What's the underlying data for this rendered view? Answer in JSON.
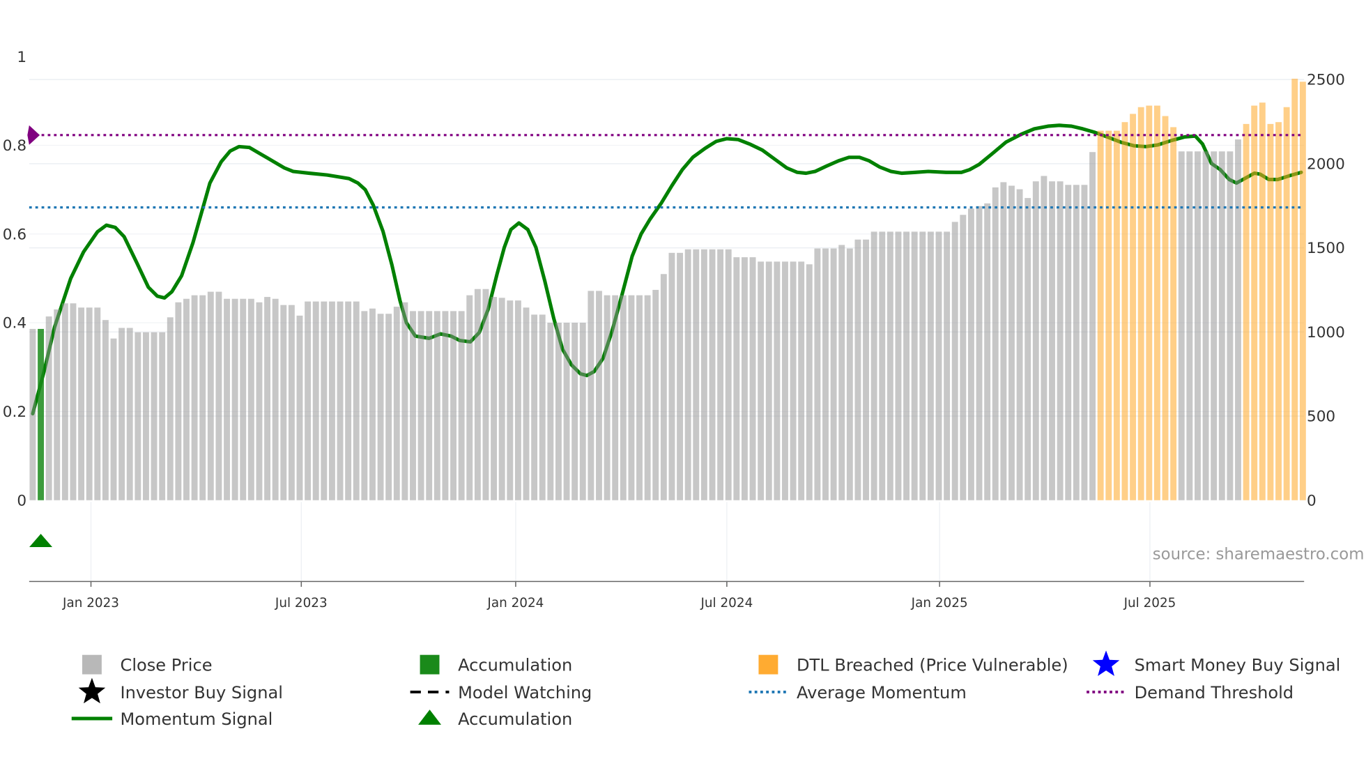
{
  "chart_data": {
    "type": "bar",
    "title": "",
    "x_unit": "week index (weekly bars)",
    "x_ticks": [
      {
        "label": "Jan 2023",
        "at": 7.2
      },
      {
        "label": "Jul 2023",
        "at": 33.2
      },
      {
        "label": "Jan 2024",
        "at": 59.7
      },
      {
        "label": "Jul 2024",
        "at": 85.8
      },
      {
        "label": "Jan 2025",
        "at": 112.1
      },
      {
        "label": "Jul 2025",
        "at": 138.1
      }
    ],
    "left_axis": {
      "range": [
        0,
        1
      ],
      "ticks": [
        "0",
        "0.2",
        "0.4",
        "0.6",
        "0.8",
        "1"
      ],
      "tick_values": [
        0,
        0.2,
        0.4,
        0.6,
        0.8,
        1
      ]
    },
    "right_axis": {
      "range": [
        0,
        2500
      ],
      "ticks": [
        "0",
        "500",
        "1000",
        "1500",
        "2000",
        "2500"
      ],
      "tick_values": [
        0,
        500,
        1000,
        1500,
        2000,
        2500
      ]
    },
    "close_price": [
      1018,
      1018,
      1092,
      1134,
      1170,
      1170,
      1145,
      1145,
      1145,
      1071,
      961,
      1024,
      1024,
      998,
      998,
      998,
      998,
      1087,
      1176,
      1197,
      1218,
      1218,
      1239,
      1239,
      1197,
      1197,
      1197,
      1197,
      1176,
      1208,
      1197,
      1160,
      1160,
      1097,
      1181,
      1181,
      1181,
      1181,
      1181,
      1181,
      1181,
      1124,
      1139,
      1108,
      1108,
      1150,
      1176,
      1124,
      1124,
      1124,
      1124,
      1124,
      1124,
      1124,
      1218,
      1255,
      1255,
      1208,
      1203,
      1187,
      1187,
      1145,
      1103,
      1103,
      1055,
      1055,
      1055,
      1055,
      1055,
      1244,
      1244,
      1218,
      1218,
      1218,
      1218,
      1218,
      1218,
      1250,
      1344,
      1470,
      1470,
      1491,
      1491,
      1491,
      1491,
      1491,
      1491,
      1444,
      1444,
      1444,
      1418,
      1418,
      1418,
      1418,
      1418,
      1418,
      1402,
      1496,
      1496,
      1496,
      1517,
      1496,
      1549,
      1549,
      1596,
      1596,
      1596,
      1596,
      1596,
      1596,
      1596,
      1596,
      1596,
      1596,
      1654,
      1696,
      1733,
      1748,
      1764,
      1859,
      1890,
      1869,
      1848,
      1796,
      1895,
      1927,
      1895,
      1895,
      1874,
      1874,
      1874,
      2069,
      2196,
      2196,
      2196,
      2247,
      2296,
      2336,
      2345,
      2345,
      2283,
      2217,
      2073,
      2073,
      2073,
      2073,
      2073,
      2073,
      2073,
      2144,
      2236,
      2345,
      2363,
      2236,
      2247,
      2336,
      2505,
      2487
    ],
    "accumulation_bar_indices": [
      1
    ],
    "dtl_breached_ranges": [
      [
        132,
        141
      ],
      [
        150,
        157
      ]
    ],
    "momentum_signal": [
      [
        0,
        0.195
      ],
      [
        1.4,
        0.29
      ],
      [
        2.7,
        0.39
      ],
      [
        4.7,
        0.5
      ],
      [
        6.3,
        0.56
      ],
      [
        8,
        0.605
      ],
      [
        9.1,
        0.62
      ],
      [
        10.2,
        0.615
      ],
      [
        11.3,
        0.594
      ],
      [
        12.9,
        0.534
      ],
      [
        14.3,
        0.48
      ],
      [
        15.4,
        0.46
      ],
      [
        16.3,
        0.456
      ],
      [
        17.2,
        0.47
      ],
      [
        18.4,
        0.506
      ],
      [
        19.8,
        0.58
      ],
      [
        20.9,
        0.65
      ],
      [
        21.9,
        0.715
      ],
      [
        23.3,
        0.763
      ],
      [
        24.4,
        0.787
      ],
      [
        25.5,
        0.797
      ],
      [
        26.8,
        0.795
      ],
      [
        28.2,
        0.78
      ],
      [
        29.8,
        0.763
      ],
      [
        31.1,
        0.749
      ],
      [
        32.2,
        0.741
      ],
      [
        34.2,
        0.737
      ],
      [
        36.4,
        0.733
      ],
      [
        39.1,
        0.725
      ],
      [
        40.2,
        0.715
      ],
      [
        41.1,
        0.7
      ],
      [
        42.1,
        0.665
      ],
      [
        43.3,
        0.606
      ],
      [
        44.4,
        0.53
      ],
      [
        45.4,
        0.45
      ],
      [
        46.2,
        0.4
      ],
      [
        47.3,
        0.37
      ],
      [
        49,
        0.365
      ],
      [
        50.4,
        0.375
      ],
      [
        51.7,
        0.37
      ],
      [
        52.8,
        0.36
      ],
      [
        54.1,
        0.357
      ],
      [
        55.2,
        0.378
      ],
      [
        56.3,
        0.43
      ],
      [
        57.4,
        0.51
      ],
      [
        58.3,
        0.57
      ],
      [
        59.1,
        0.61
      ],
      [
        60.1,
        0.625
      ],
      [
        61.2,
        0.61
      ],
      [
        62.2,
        0.57
      ],
      [
        63.3,
        0.494
      ],
      [
        64.4,
        0.41
      ],
      [
        65.5,
        0.34
      ],
      [
        66.6,
        0.305
      ],
      [
        67.7,
        0.285
      ],
      [
        68.5,
        0.281
      ],
      [
        69.4,
        0.29
      ],
      [
        70.5,
        0.32
      ],
      [
        71.6,
        0.38
      ],
      [
        72.8,
        0.46
      ],
      [
        74.1,
        0.55
      ],
      [
        75.2,
        0.6
      ],
      [
        76.3,
        0.633
      ],
      [
        77.7,
        0.67
      ],
      [
        79,
        0.709
      ],
      [
        80.3,
        0.745
      ],
      [
        81.6,
        0.773
      ],
      [
        83.1,
        0.793
      ],
      [
        84.5,
        0.809
      ],
      [
        85.8,
        0.815
      ],
      [
        87.2,
        0.813
      ],
      [
        88.6,
        0.803
      ],
      [
        90.2,
        0.789
      ],
      [
        91.7,
        0.769
      ],
      [
        93.2,
        0.749
      ],
      [
        94.5,
        0.739
      ],
      [
        95.6,
        0.737
      ],
      [
        96.7,
        0.741
      ],
      [
        98.1,
        0.753
      ],
      [
        99.6,
        0.765
      ],
      [
        100.9,
        0.773
      ],
      [
        102.2,
        0.773
      ],
      [
        103.4,
        0.765
      ],
      [
        104.7,
        0.751
      ],
      [
        106.1,
        0.741
      ],
      [
        107.4,
        0.737
      ],
      [
        109.1,
        0.739
      ],
      [
        110.7,
        0.741
      ],
      [
        112.9,
        0.739
      ],
      [
        114.8,
        0.739
      ],
      [
        115.8,
        0.745
      ],
      [
        117,
        0.757
      ],
      [
        118.6,
        0.781
      ],
      [
        120.3,
        0.807
      ],
      [
        122.2,
        0.825
      ],
      [
        123.8,
        0.837
      ],
      [
        125.5,
        0.843
      ],
      [
        126.9,
        0.845
      ],
      [
        128.4,
        0.843
      ],
      [
        129.8,
        0.837
      ],
      [
        131.3,
        0.829
      ],
      [
        132.8,
        0.819
      ],
      [
        134.5,
        0.807
      ],
      [
        136.1,
        0.799
      ],
      [
        137.6,
        0.797
      ],
      [
        139.1,
        0.801
      ],
      [
        140.8,
        0.811
      ],
      [
        142.4,
        0.819
      ],
      [
        143.7,
        0.821
      ],
      [
        144.6,
        0.803
      ],
      [
        145.7,
        0.759
      ],
      [
        146.8,
        0.745
      ],
      [
        147.9,
        0.723
      ],
      [
        148.8,
        0.715
      ],
      [
        149.8,
        0.725
      ],
      [
        151,
        0.737
      ],
      [
        151.7,
        0.735
      ],
      [
        152.8,
        0.723
      ],
      [
        153.9,
        0.723
      ],
      [
        155.3,
        0.731
      ],
      [
        156.8,
        0.739
      ]
    ],
    "average_momentum": 0.66,
    "demand_threshold": 0.823,
    "accumulation_markers": [
      1
    ],
    "colors": {
      "close_price": "#c7c7c7",
      "accumulation_bar": "#1a8a1a",
      "dtl_breached": "#ffa726",
      "momentum": "#008000",
      "average_momentum": "#1f77b4",
      "demand_threshold": "#800080",
      "smart_money": "#0000ff",
      "investor_buy": "#000000"
    },
    "source": "source: sharemaestro.com",
    "legend": [
      {
        "label": "Close Price",
        "marker": "square",
        "color": "#b8b8b8"
      },
      {
        "label": "Accumulation",
        "marker": "square",
        "color": "#1a8a1a"
      },
      {
        "label": "DTL Breached (Price Vulnerable)",
        "marker": "square",
        "color": "#ffa726"
      },
      {
        "label": "Smart Money Buy Signal",
        "marker": "star",
        "color": "#0000ff"
      },
      {
        "label": "Investor Buy Signal",
        "marker": "star",
        "color": "#000000"
      },
      {
        "label": "Model Watching",
        "marker": "dashed-line",
        "color": "#000000"
      },
      {
        "label": "Average Momentum",
        "marker": "dotted-line",
        "color": "#1f77b4"
      },
      {
        "label": "Demand Threshold",
        "marker": "dotted-line",
        "color": "#800080"
      },
      {
        "label": "Momentum Signal",
        "marker": "line",
        "color": "#008000"
      },
      {
        "label": "Accumulation",
        "marker": "triangle",
        "color": "#008000"
      }
    ]
  }
}
